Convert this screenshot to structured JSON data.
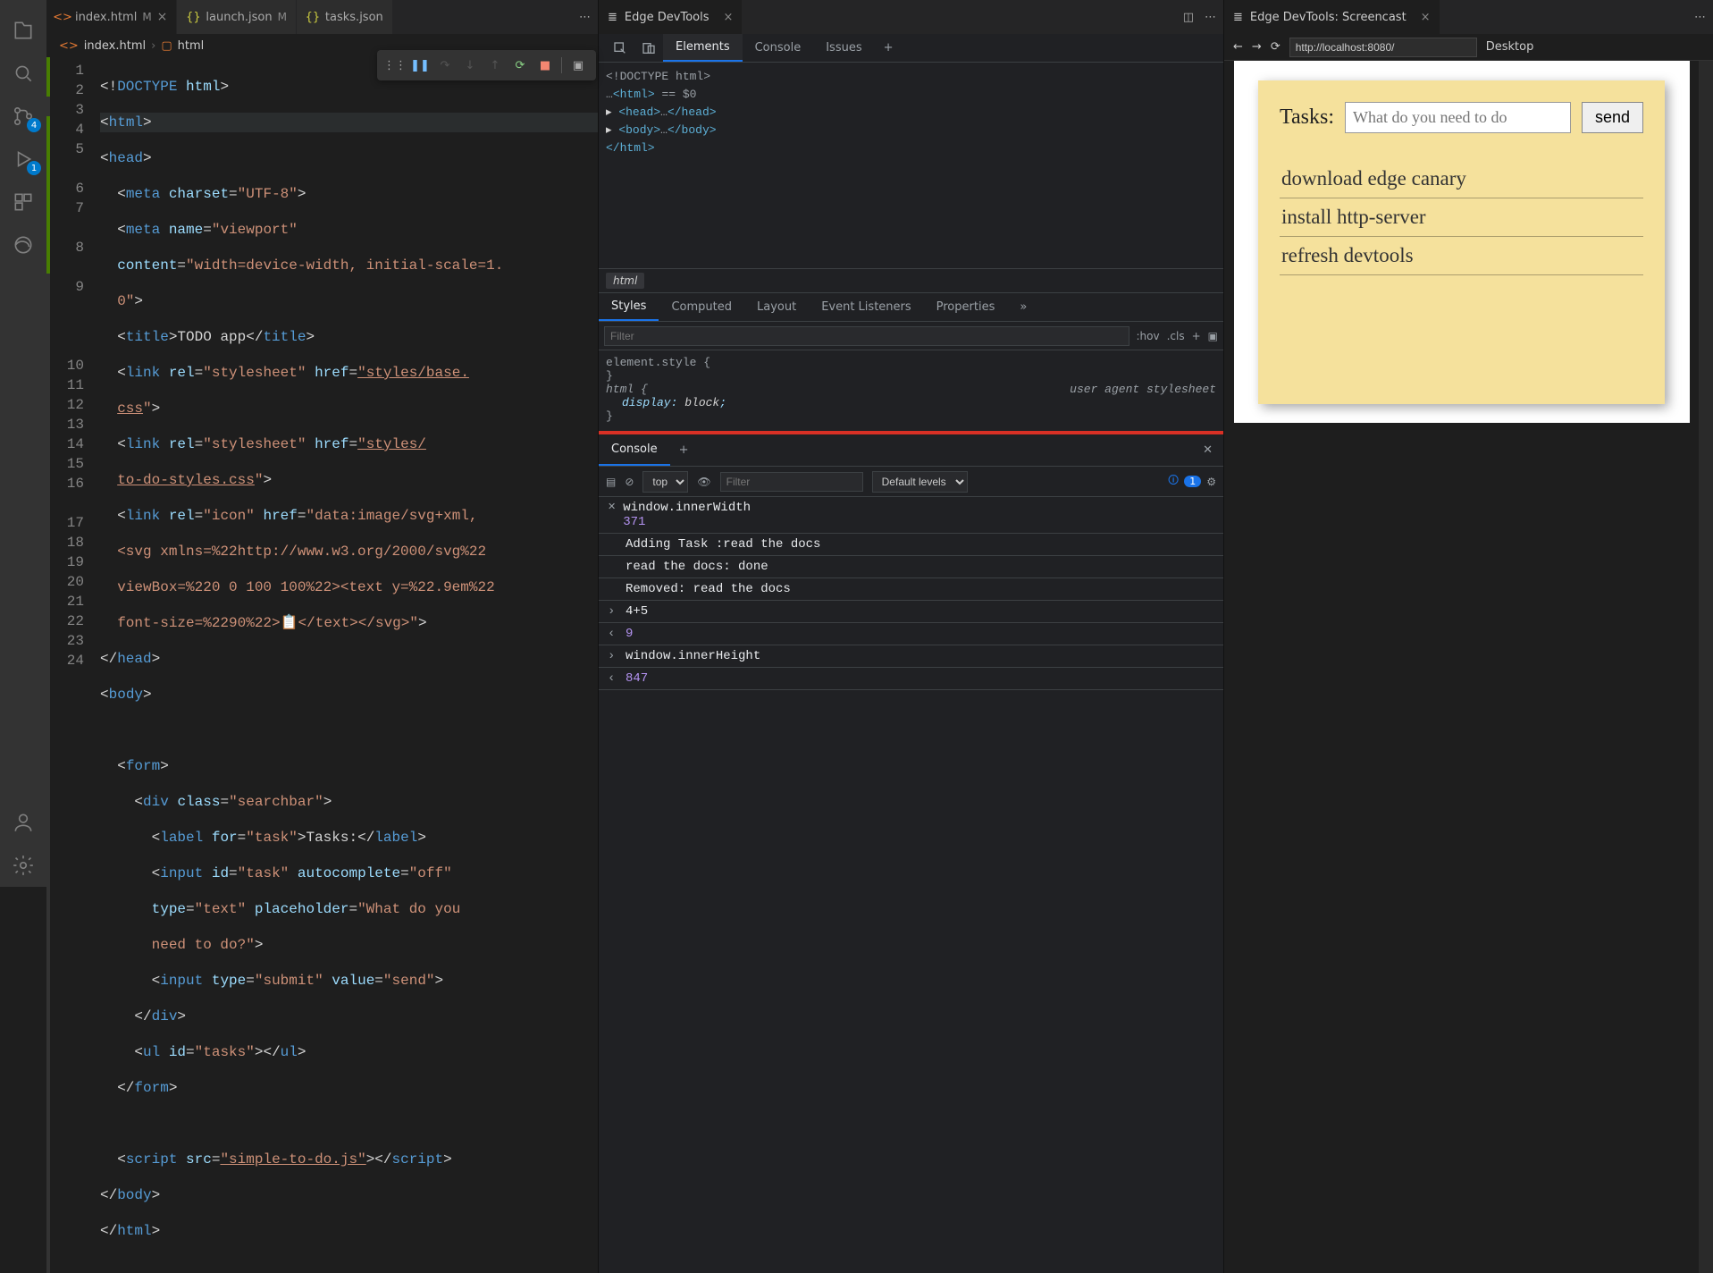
{
  "activity": {
    "scm_badge": "4",
    "debug_badge": "1"
  },
  "tabs": {
    "items": [
      {
        "label": "index.html",
        "mod": "M"
      },
      {
        "label": "launch.json",
        "mod": "M"
      },
      {
        "label": "tasks.json",
        "mod": ""
      }
    ]
  },
  "breadcrumb": {
    "file": "index.html",
    "symbol": "html"
  },
  "gutter": [
    "1",
    "2",
    "3",
    "4",
    "5",
    "",
    "6",
    "7",
    "",
    "8",
    "",
    "9",
    "",
    "",
    "",
    "10",
    "11",
    "12",
    "13",
    "14",
    "15",
    "16",
    "",
    "17",
    "18",
    "19",
    "20",
    "21",
    "22",
    "23",
    "24"
  ],
  "devtools": {
    "title": "Edge DevTools",
    "nav": {
      "elements": "Elements",
      "console": "Console",
      "issues": "Issues"
    },
    "dom": {
      "doctype": "<!DOCTYPE html>",
      "html_open": "<html>",
      "html_eq": "== $0",
      "head": "<head>…</head>",
      "body": "<body>…</body>",
      "html_close": "</html>",
      "crumb": "html"
    },
    "style_tabs": {
      "styles": "Styles",
      "computed": "Computed",
      "layout": "Layout",
      "events": "Event Listeners",
      "props": "Properties"
    },
    "filter": {
      "placeholder": "Filter",
      "hov": ":hov",
      "cls": ".cls"
    },
    "styles": {
      "selector": "element.style {",
      "close": "}",
      "htmlsel": "html {",
      "prop": "display",
      "val": "block",
      "semi": ";",
      "note": "user agent stylesheet"
    },
    "console": {
      "tab": "Console",
      "context": "top",
      "filter_placeholder": "Filter",
      "levels": "Default levels",
      "issues_count": "1",
      "logs": {
        "l0": "window.innerWidth",
        "l1": "371",
        "l2": "Adding Task :read the docs",
        "l3": "read the docs: done",
        "l4": "Removed: read the docs",
        "l5": "4+5",
        "l6": "9",
        "l7": "window.innerHeight",
        "l8": "847"
      }
    }
  },
  "screencast": {
    "title": "Edge DevTools: Screencast",
    "url": "http://localhost:8080/",
    "mode": "Desktop",
    "app": {
      "heading": "Tasks:",
      "input_placeholder": "What do you need to do",
      "send": "send",
      "tasks": [
        "download edge canary",
        "install http-server",
        "refresh devtools"
      ]
    }
  }
}
